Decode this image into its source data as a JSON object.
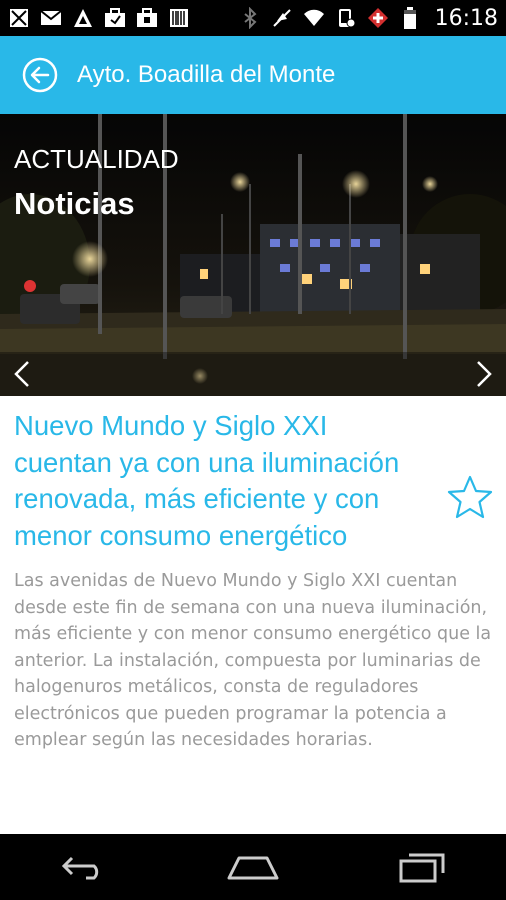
{
  "status_bar": {
    "time": "16:18",
    "icons_left": [
      "screenshot-icon",
      "gmail-icon",
      "app-icon",
      "briefcase-icon",
      "briefcase-icon",
      "barcode-icon"
    ],
    "icons_right": [
      "bluetooth-icon",
      "mute-icon",
      "wifi-icon",
      "phone-icon",
      "swiss-flag-icon",
      "battery-icon"
    ]
  },
  "app_bar": {
    "title": "Ayto. Boadilla del Monte",
    "accent_color": "#29b8e8"
  },
  "hero": {
    "section": "ACTUALIDAD",
    "title": "Noticias"
  },
  "article": {
    "title": "Nuevo Mundo y Siglo XXI cuentan ya con una iluminación renovada, más eficiente y con menor consumo energético",
    "body": "Las avenidas de Nuevo Mundo y Siglo XXI cuentan desde este fin de semana con una nueva iluminación,  más eficiente y con menor consumo energético que la anterior. La instalación, compuesta por luminarias de halogenuros metálicos, consta de reguladores electrónicos que pueden programar la potencia a emplear según las necesidades horarias."
  },
  "system_nav": [
    "back-icon",
    "home-icon",
    "recents-icon"
  ]
}
